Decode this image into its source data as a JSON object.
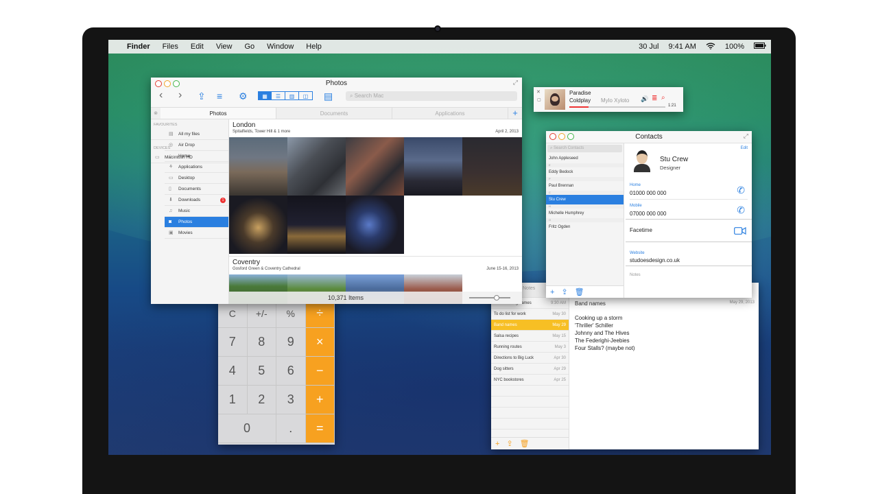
{
  "menubar": {
    "items": [
      "Finder",
      "Files",
      "Edit",
      "View",
      "Go",
      "Window",
      "Help"
    ],
    "date": "30 Jul",
    "time": "9:41 AM",
    "battery": "100%"
  },
  "finder": {
    "title": "Photos",
    "search_placeholder": "Search Mac",
    "tabs": [
      "Photos",
      "Documents",
      "Applications"
    ],
    "sidebar_header_favourites": "FAVOURITES",
    "sidebar": [
      "All my files",
      "Air Drop",
      "Home",
      "Applications",
      "Desktop",
      "Documents",
      "Downloads",
      "Music",
      "Photos",
      "Movies"
    ],
    "downloads_badge": "1",
    "sidebar_header_devices": "DEVICES",
    "device": "Macintosh HD",
    "album1": {
      "title": "London",
      "subtitle": "Spitalfields, Tower Hill & 1 more",
      "date": "April 2, 2013"
    },
    "album2": {
      "title": "Coventry",
      "subtitle": "Gosford Green & Coventry Cathedral",
      "date": "June 15-16, 2013"
    },
    "item_count": "10,371 Items"
  },
  "music": {
    "song": "Paradise",
    "artist": "Coldplay",
    "album": "Mylo Xyloto",
    "time": "1:21",
    "progress": 0.2
  },
  "contacts": {
    "title": "Contacts",
    "search_placeholder": "Search Contacts",
    "edit": "Edit",
    "list": [
      {
        "type": "name",
        "text": "John Appleseed"
      },
      {
        "type": "letter",
        "text": "E"
      },
      {
        "type": "name",
        "text": "Eddy Bedock"
      },
      {
        "type": "letter",
        "text": "P"
      },
      {
        "type": "name",
        "text": "Paul Brennan"
      },
      {
        "type": "letter",
        "text": "C"
      },
      {
        "type": "name",
        "text": "Stu Crew",
        "selected": true
      },
      {
        "type": "letter",
        "text": "H"
      },
      {
        "type": "name",
        "text": "Michelle Humphrey"
      },
      {
        "type": "letter",
        "text": "O"
      },
      {
        "type": "name",
        "text": "Fritz Ogden"
      }
    ],
    "name": "Stu Crew",
    "role": "Designer",
    "home_label": "Home",
    "home": "01000 000 000",
    "mobile_label": "Mobile",
    "mobile": "07000 000 000",
    "facetime": "Facetime",
    "website_label": "Website",
    "website": "studoesdesign.co.uk",
    "notes_label": "Notes"
  },
  "calculator": {
    "rows": [
      [
        "C",
        "+/-",
        "%",
        "÷"
      ],
      [
        "7",
        "8",
        "9",
        "×"
      ],
      [
        "4",
        "5",
        "6",
        "−"
      ],
      [
        "1",
        "2",
        "3",
        "+"
      ],
      [
        "0",
        ".",
        "="
      ]
    ]
  },
  "notes": {
    "title": "Notes",
    "list": [
      {
        "title": "Potential dog names",
        "date": "9:30 AM"
      },
      {
        "title": "To do list for work",
        "date": "May 30"
      },
      {
        "title": "Band names",
        "date": "May 29",
        "selected": true
      },
      {
        "title": "Salsa recipes",
        "date": "May 15"
      },
      {
        "title": "Running routes",
        "date": "May 3"
      },
      {
        "title": "Directions to Big Luck",
        "date": "Apr 30"
      },
      {
        "title": "Dog sitters",
        "date": "Apr 29"
      },
      {
        "title": "NYC bookstores",
        "date": "Apr 25"
      }
    ],
    "heading": "Band names",
    "date": "May 29, 2013",
    "body": [
      "Cooking up a storm",
      "'Thriller' Schiller",
      "Johnny and The Hives",
      "The Federighi-Jeebies",
      "Four Stalls? (maybe not)"
    ]
  }
}
